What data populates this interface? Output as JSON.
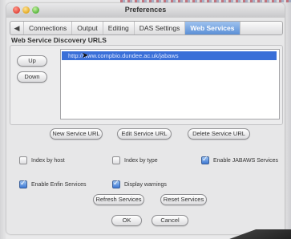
{
  "window": {
    "title": "Preferences"
  },
  "tabs": {
    "prev_arrow": "◀",
    "items": [
      {
        "label": "Connections",
        "selected": false
      },
      {
        "label": "Output",
        "selected": false
      },
      {
        "label": "Editing",
        "selected": false
      },
      {
        "label": "DAS Settings",
        "selected": false
      },
      {
        "label": "Web Services",
        "selected": true
      }
    ]
  },
  "section": {
    "title": "Web Service Discovery URLS"
  },
  "list": {
    "up_label": "Up",
    "down_label": "Down",
    "urls": [
      "http://www.compbio.dundee.ac.uk/jabaws"
    ]
  },
  "url_actions": {
    "new_label": "New Service URL",
    "edit_label": "Edit Service URL",
    "delete_label": "Delete Service URL"
  },
  "options": {
    "index_by_host": {
      "label": "Index by host",
      "checked": false
    },
    "index_by_type": {
      "label": "Index by type",
      "checked": false
    },
    "enable_jabaws": {
      "label": "Enable JABAWS Services",
      "checked": true
    },
    "enable_enfin": {
      "label": "Enable Enfin Services",
      "checked": true
    },
    "display_warnings": {
      "label": "Display warnings",
      "checked": true
    }
  },
  "services": {
    "refresh_label": "Refresh Services",
    "reset_label": "Reset Services"
  },
  "dialog": {
    "ok_label": "OK",
    "cancel_label": "Cancel"
  },
  "colors": {
    "selection": "#3a6fd8",
    "selected_tab": "#5b8fd6",
    "checkbox_checked": "#3d78d3"
  }
}
